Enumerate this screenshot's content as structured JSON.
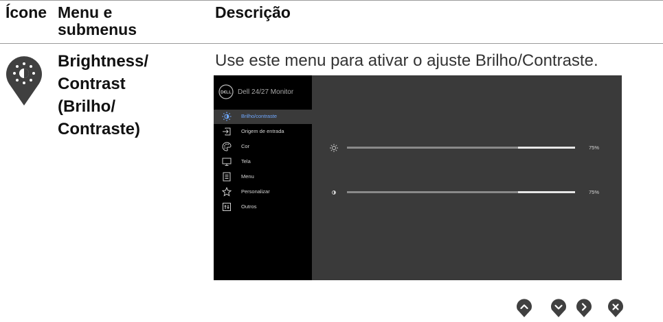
{
  "table": {
    "headers": {
      "icon": "Ícone",
      "menu_line1": "Menu e",
      "menu_line2": "submenus",
      "description": "Descrição"
    },
    "row": {
      "title_lines": [
        "Brightness/",
        "Contrast",
        "(Brilho/",
        "Contraste)"
      ],
      "description": "Use este menu para ativar o ajuste Brilho/Contraste."
    }
  },
  "osd": {
    "title": "Dell 24/27 Monitor",
    "menu_items": [
      {
        "label": "Brilho/contraste",
        "icon": "brightness-icon",
        "selected": true
      },
      {
        "label": "Origem de entrada",
        "icon": "input-source-icon",
        "selected": false
      },
      {
        "label": "Cor",
        "icon": "color-palette-icon",
        "selected": false
      },
      {
        "label": "Tela",
        "icon": "display-icon",
        "selected": false
      },
      {
        "label": "Menu",
        "icon": "menu-icon",
        "selected": false
      },
      {
        "label": "Personalizar",
        "icon": "star-icon",
        "selected": false
      },
      {
        "label": "Outros",
        "icon": "others-icon",
        "selected": false
      }
    ],
    "sliders": [
      {
        "name": "brightness",
        "icon": "sun-icon",
        "value_text": "75%",
        "value": 0.75
      },
      {
        "name": "contrast",
        "icon": "contrast-icon",
        "value_text": "75%",
        "value": 0.75
      }
    ]
  },
  "nav_buttons": [
    {
      "name": "up-button",
      "icon": "chevron-up-icon"
    },
    {
      "name": "down-button",
      "icon": "chevron-down-icon"
    },
    {
      "name": "right-button",
      "icon": "chevron-right-icon"
    },
    {
      "name": "close-button",
      "icon": "close-icon"
    }
  ],
  "colors": {
    "osd_background": "#3a3a3a",
    "osd_sidebar": "#000000",
    "selected_label": "#6fa8ff",
    "slider_fill": "#8a8a8a",
    "slider_track": "#e6e6e6",
    "icon_dark": "#404040"
  }
}
